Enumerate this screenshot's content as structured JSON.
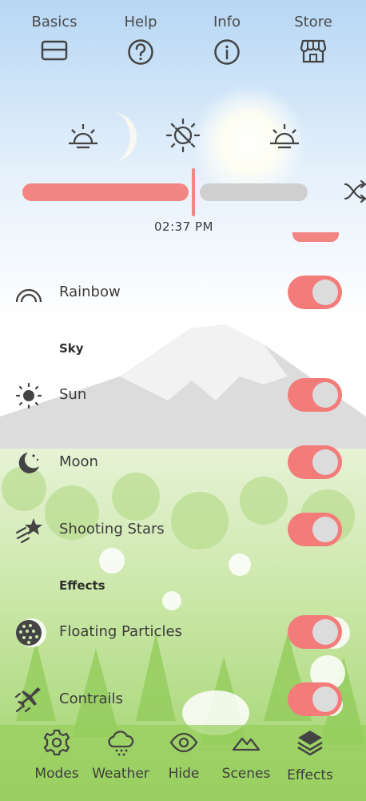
{
  "top_nav": {
    "basics": "Basics",
    "help": "Help",
    "info": "Info",
    "store": "Store"
  },
  "time_icons": [
    "sunrise-icon",
    "solar-noon-icon",
    "sunset-icon"
  ],
  "time_slider": {
    "progress": 0.59,
    "readout": "02:37 PM"
  },
  "toggles": {
    "rainbow": {
      "label": "Rainbow",
      "on": true
    },
    "sun": {
      "label": "Sun",
      "on": true
    },
    "moon": {
      "label": "Moon",
      "on": true
    },
    "shooting_stars": {
      "label": "Shooting Stars",
      "on": true
    },
    "floating_particles": {
      "label": "Floating Particles",
      "on": true
    },
    "contrails": {
      "label": "Contrails",
      "on": true
    }
  },
  "sections": {
    "sky": "Sky",
    "effects": "Effects"
  },
  "tabs": {
    "modes": "Modes",
    "weather": "Weather",
    "hide": "Hide",
    "scenes": "Scenes",
    "effects": "Effects"
  },
  "colors": {
    "accent": "#f37c7a",
    "track_off": "#cfcfcf",
    "knob": "#dcdcdc",
    "text": "#3c3c3c"
  }
}
